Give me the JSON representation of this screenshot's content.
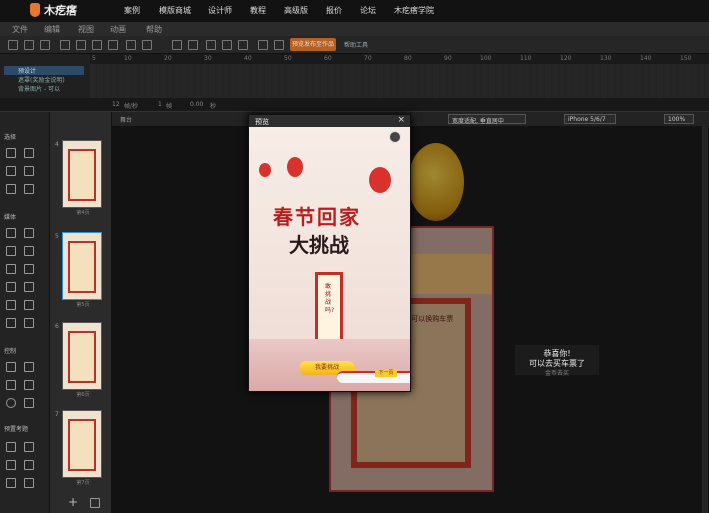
{
  "brand": {
    "logo_text": "木疙瘩"
  },
  "topnav": [
    "案例",
    "模版商城",
    "设计师",
    "教程",
    "高级版",
    "报价",
    "论坛",
    "木疙瘩学院"
  ],
  "menubar": [
    "文件",
    "编辑",
    "视图",
    "动画",
    "帮助"
  ],
  "toolbar": {
    "publish_button": "预览发布至作品",
    "help_label": "帮助工具"
  },
  "timeline": {
    "ruler_ticks": [
      "5",
      "10",
      "20",
      "30",
      "40",
      "50",
      "60",
      "70",
      "80",
      "90",
      "100",
      "110",
      "120",
      "130",
      "140",
      "150"
    ],
    "layers": [
      "预设计",
      "遮罩(奖励金说明)",
      "背景图片 - 可以"
    ]
  },
  "status": {
    "fps": "12",
    "fps_unit": "帧/秒",
    "frame": "1",
    "frame_unit": "帧",
    "time": "0.00",
    "time_unit": "秒"
  },
  "left_panel": {
    "sections": [
      "选择",
      "媒体",
      "控制",
      "预置考题"
    ]
  },
  "thumbnails": [
    {
      "num": "4",
      "caption": "第4页"
    },
    {
      "num": "5",
      "caption": "第5页"
    },
    {
      "num": "6",
      "caption": "第6页"
    },
    {
      "num": "7",
      "caption": "第7页"
    }
  ],
  "canvas_bar": {
    "left_label": "舞台",
    "fit_mode": "宽度适配, 垂直居中",
    "device": "iPhone 5/6/7",
    "zoom": "100%"
  },
  "canvas": {
    "bg_side_text": "领取金币 可以换购车票",
    "toast_line1": "恭喜你!",
    "toast_line2": "可以去买车票了",
    "toast_line3": "金币去买"
  },
  "dialog": {
    "title": "预览",
    "close": "×",
    "heading_line1": "春节回家",
    "heading_line2": "大挑战",
    "scroll_text": "敢挑战吗?",
    "start_button": "我要挑战",
    "next_button": "下一页"
  },
  "colors": {
    "accent_orange": "#b56125",
    "festive_red": "#c62d24",
    "gold": "#f2b31b"
  }
}
